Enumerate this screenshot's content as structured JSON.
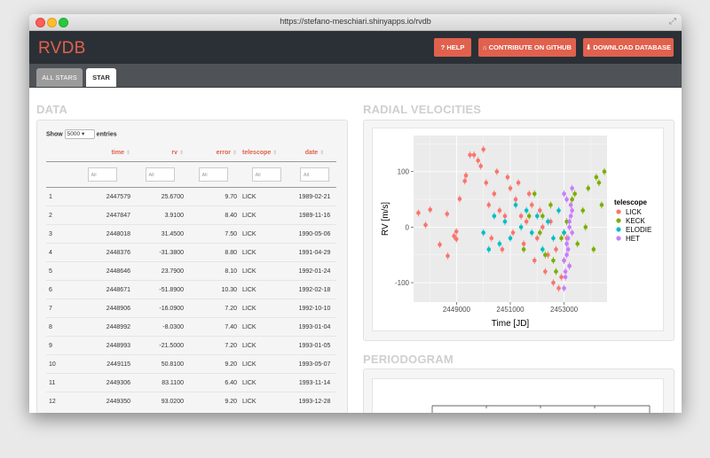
{
  "browser": {
    "url": "https://stefano-meschiari.shinyapps.io/rvdb"
  },
  "navbar": {
    "brand": "RVDB",
    "help": "? HELP",
    "contribute": "⌂ CONTRIBUTE ON GITHUB",
    "download": "⬇ DOWNLOAD DATABASE"
  },
  "tabs": [
    {
      "label": "ALL STARS"
    },
    {
      "label": "STAR"
    }
  ],
  "sections": {
    "data": "DATA",
    "rv": "RADIAL VELOCITIES",
    "periodogram": "PERIODOGRAM"
  },
  "table": {
    "show_label": "Show",
    "show_value": "5000",
    "entries_label": "entries",
    "columns": [
      "time",
      "rv",
      "error",
      "telescope",
      "date"
    ],
    "filter_placeholder": "All",
    "rows": [
      [
        "1",
        "2447579",
        "25.6700",
        "9.70",
        "LICK",
        "1989-02-21"
      ],
      [
        "2",
        "2447847",
        "3.9100",
        "8.40",
        "LICK",
        "1989-11-16"
      ],
      [
        "3",
        "2448018",
        "31.4500",
        "7.50",
        "LICK",
        "1990-05-06"
      ],
      [
        "4",
        "2448376",
        "-31.3800",
        "8.80",
        "LICK",
        "1991-04-29"
      ],
      [
        "5",
        "2448646",
        "23.7900",
        "8.10",
        "LICK",
        "1992-01-24"
      ],
      [
        "6",
        "2448671",
        "-51.8900",
        "10.30",
        "LICK",
        "1992-02-18"
      ],
      [
        "7",
        "2448906",
        "-16.0900",
        "7.20",
        "LICK",
        "1992-10-10"
      ],
      [
        "8",
        "2448992",
        "-8.0300",
        "7.40",
        "LICK",
        "1993-01-04"
      ],
      [
        "9",
        "2448993",
        "-21.5000",
        "7.20",
        "LICK",
        "1993-01-05"
      ],
      [
        "10",
        "2449115",
        "50.8100",
        "9.20",
        "LICK",
        "1993-05-07"
      ],
      [
        "11",
        "2449306",
        "83.1100",
        "6.40",
        "LICK",
        "1993-11-14"
      ],
      [
        "12",
        "2449350",
        "93.0200",
        "9.20",
        "LICK",
        "1993-12-28"
      ]
    ]
  },
  "colors": {
    "accent": "#e0614d",
    "LICK": "#F8766D",
    "KECK": "#7CAE00",
    "ELODIE": "#00BFC4",
    "HET": "#C77CFF"
  },
  "chart_data": {
    "type": "scatter",
    "xlabel": "Time [JD]",
    "ylabel": "RV [m/s]",
    "xlim": [
      2447400,
      2454600
    ],
    "ylim": [
      -135,
      165
    ],
    "xticks": [
      2449000,
      2451000,
      2453000
    ],
    "xtick_labels": [
      "2449000",
      "2451000",
      "2453000"
    ],
    "yticks": [
      -100,
      0,
      100
    ],
    "ytick_labels": [
      "-100",
      "0",
      "100"
    ],
    "grid": true,
    "legend_title": "telescope",
    "legend_position": "right",
    "series": [
      {
        "name": "LICK",
        "x": [
          2447579,
          2447847,
          2448018,
          2448376,
          2448646,
          2448671,
          2448906,
          2448992,
          2448993,
          2449115,
          2449306,
          2449350,
          2449500,
          2449650,
          2449800,
          2449900,
          2450000,
          2450100,
          2450200,
          2450300,
          2450400,
          2450500,
          2450600,
          2450700,
          2450800,
          2450900,
          2451000,
          2451100,
          2451200,
          2451300,
          2451400,
          2451500,
          2451600,
          2451700,
          2451800,
          2451900,
          2452000,
          2452100,
          2452200,
          2452300,
          2452400,
          2452500,
          2452600,
          2452700,
          2452800,
          2452900,
          2453000,
          2453100,
          2453200
        ],
        "y": [
          25.67,
          3.91,
          31.45,
          -31.38,
          23.79,
          -51.89,
          -16.09,
          -8.03,
          -21.5,
          50.81,
          83.11,
          93.02,
          130,
          130,
          120,
          110,
          140,
          80,
          40,
          -20,
          60,
          100,
          30,
          -40,
          20,
          90,
          70,
          -10,
          50,
          80,
          20,
          -30,
          10,
          60,
          40,
          -60,
          -20,
          30,
          0,
          -80,
          -50,
          10,
          -100,
          -40,
          -110,
          -90,
          -60,
          -20,
          -70
        ]
      },
      {
        "name": "KECK",
        "x": [
          2451500,
          2451700,
          2451900,
          2452100,
          2452300,
          2452500,
          2452700,
          2452900,
          2453100,
          2453300,
          2453500,
          2453700,
          2453900,
          2454100,
          2454300,
          2454500,
          2452200,
          2452600,
          2453000,
          2453400,
          2453800,
          2454200,
          2454400
        ],
        "y": [
          -40,
          20,
          60,
          -10,
          -50,
          40,
          -80,
          -20,
          10,
          50,
          -30,
          30,
          70,
          -40,
          80,
          100,
          20,
          -60,
          -10,
          60,
          0,
          90,
          40
        ]
      },
      {
        "name": "ELODIE",
        "x": [
          2450000,
          2450200,
          2450400,
          2450600,
          2450800,
          2451000,
          2451200,
          2451400,
          2451600,
          2451800,
          2452000,
          2452200,
          2452400,
          2452600,
          2452800,
          2453000
        ],
        "y": [
          -10,
          -40,
          20,
          -30,
          10,
          -20,
          40,
          0,
          30,
          -10,
          20,
          -40,
          10,
          -20,
          30,
          -10
        ]
      },
      {
        "name": "HET",
        "x": [
          2453000,
          2453050,
          2453100,
          2453150,
          2453200,
          2453250,
          2453300,
          2453000,
          2453100,
          2453200,
          2453300,
          2453050,
          2453150,
          2453250,
          2453000,
          2453100,
          2453200,
          2453300
        ],
        "y": [
          -110,
          -80,
          -50,
          -20,
          10,
          40,
          70,
          -60,
          -30,
          0,
          30,
          -90,
          -40,
          20,
          60,
          50,
          -70,
          -10
        ]
      }
    ]
  }
}
